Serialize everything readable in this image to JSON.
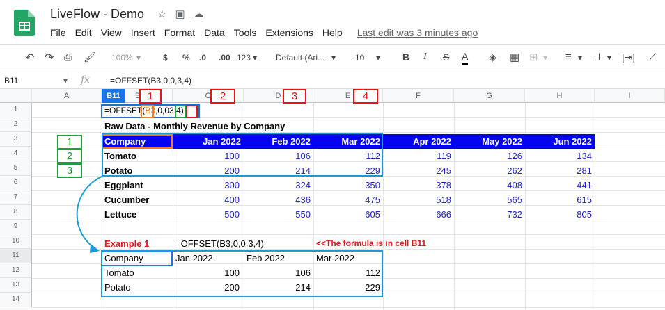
{
  "app": {
    "title": "LiveFlow - Demo",
    "menu": [
      "File",
      "Edit",
      "View",
      "Insert",
      "Format",
      "Data",
      "Tools",
      "Extensions",
      "Help"
    ],
    "last_edit": "Last edit was 3 minutes ago"
  },
  "toolbar": {
    "zoom": "100%",
    "currency": "$",
    "percent": "%",
    "dec_less": ".0",
    "dec_more": ".00",
    "format": "123",
    "font": "Default (Ari...",
    "size": "10",
    "bold": "B",
    "italic": "I",
    "strike": "S",
    "textcolor": "A"
  },
  "formula_bar": {
    "cell_ref": "B11",
    "fx": "fx",
    "formula": "=OFFSET(B3,0,0,3,4)"
  },
  "columns": [
    "A",
    "B11",
    "C",
    "D",
    "E",
    "F",
    "G",
    "H",
    "I"
  ],
  "rows": [
    "1",
    "2",
    "3",
    "4",
    "5",
    "6",
    "7",
    "8",
    "9",
    "10",
    "11",
    "12",
    "13",
    "14"
  ],
  "sheet": {
    "b1_formula": "=OFFSET(B3,0,0,3,4)",
    "b1_parts": {
      "fn": "=OFFSET(",
      "ref": "B3",
      "mid": ",0,0",
      "h": "3",
      "comma": ",",
      "w": "4",
      "close": ")"
    },
    "raw_title": "Raw Data - Monthly Revenue by Company",
    "header": [
      "Company",
      "Jan 2022",
      "Feb 2022",
      "Mar 2022",
      "Apr 2022",
      "May 2022",
      "Jun 2022"
    ],
    "data": [
      {
        "company": "Tomato",
        "values": [
          "100",
          "106",
          "112",
          "119",
          "126",
          "134"
        ]
      },
      {
        "company": "Potato",
        "values": [
          "200",
          "214",
          "229",
          "245",
          "262",
          "281"
        ]
      },
      {
        "company": "Eggplant",
        "values": [
          "300",
          "324",
          "350",
          "378",
          "408",
          "441"
        ]
      },
      {
        "company": "Cucumber",
        "values": [
          "400",
          "436",
          "475",
          "518",
          "565",
          "615"
        ]
      },
      {
        "company": "Lettuce",
        "values": [
          "500",
          "550",
          "605",
          "666",
          "732",
          "805"
        ]
      }
    ],
    "example_label": "Example 1",
    "example_formula": "=OFFSET(B3,0,0,3,4)",
    "example_note": "<<The formula is in cell B11",
    "result_header": [
      "Company",
      "Jan 2022",
      "Feb 2022",
      "Mar 2022"
    ],
    "result_rows": [
      {
        "company": "Tomato",
        "values": [
          "100",
          "106",
          "112"
        ]
      },
      {
        "company": "Potato",
        "values": [
          "200",
          "214",
          "229"
        ]
      }
    ]
  },
  "annotations": {
    "col_badges": [
      "1",
      "2",
      "3",
      "4"
    ],
    "row_badges": [
      "1",
      "2",
      "3"
    ],
    "colors": {
      "red": "#e8141a",
      "green": "#1e9e3c",
      "orange": "#f07c1e",
      "blue": "#1f6fd1",
      "header_blue": "#0303f0"
    }
  }
}
